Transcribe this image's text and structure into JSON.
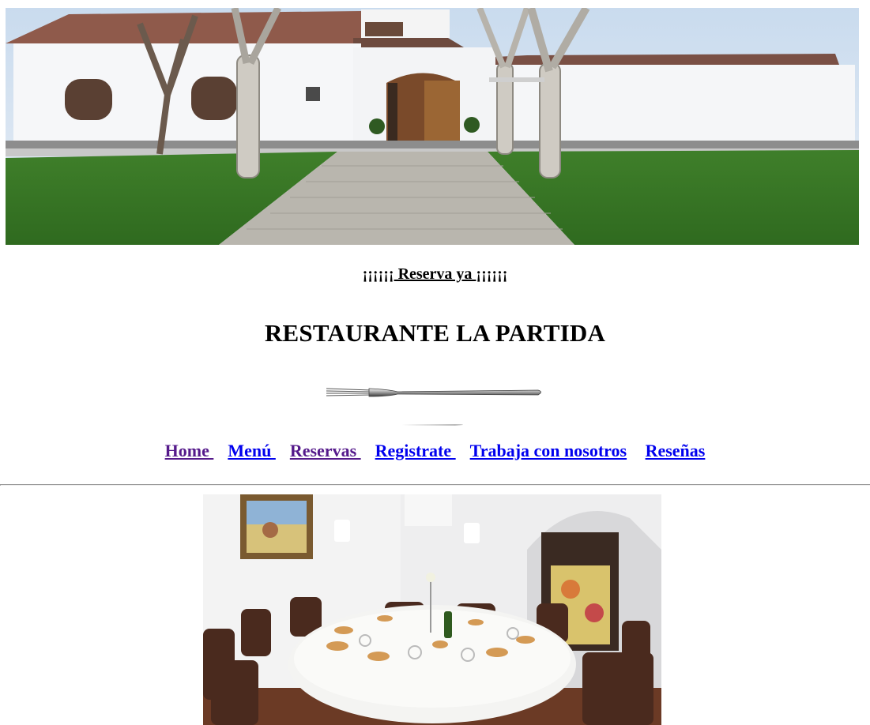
{
  "hero": {
    "image": "restaurant-facade-photo"
  },
  "reserve": {
    "prefix": "¡¡¡¡¡¡",
    "link": " Reserva ya ",
    "suffix": "¡¡¡¡¡¡"
  },
  "title": "RESTAURANTE LA PARTIDA",
  "nav": {
    "home": "Home ",
    "menu": "Menú ",
    "reservas": "Reservas ",
    "registrate": "Registrate ",
    "trabaja": "Trabaja con nosotros",
    "resenas": "Reseñas"
  },
  "dining": {
    "image": "dining-room-round-table-photo"
  },
  "colors": {
    "link": "#0000ee",
    "visited": "#551a8b",
    "rule": "#9a9a9a"
  }
}
